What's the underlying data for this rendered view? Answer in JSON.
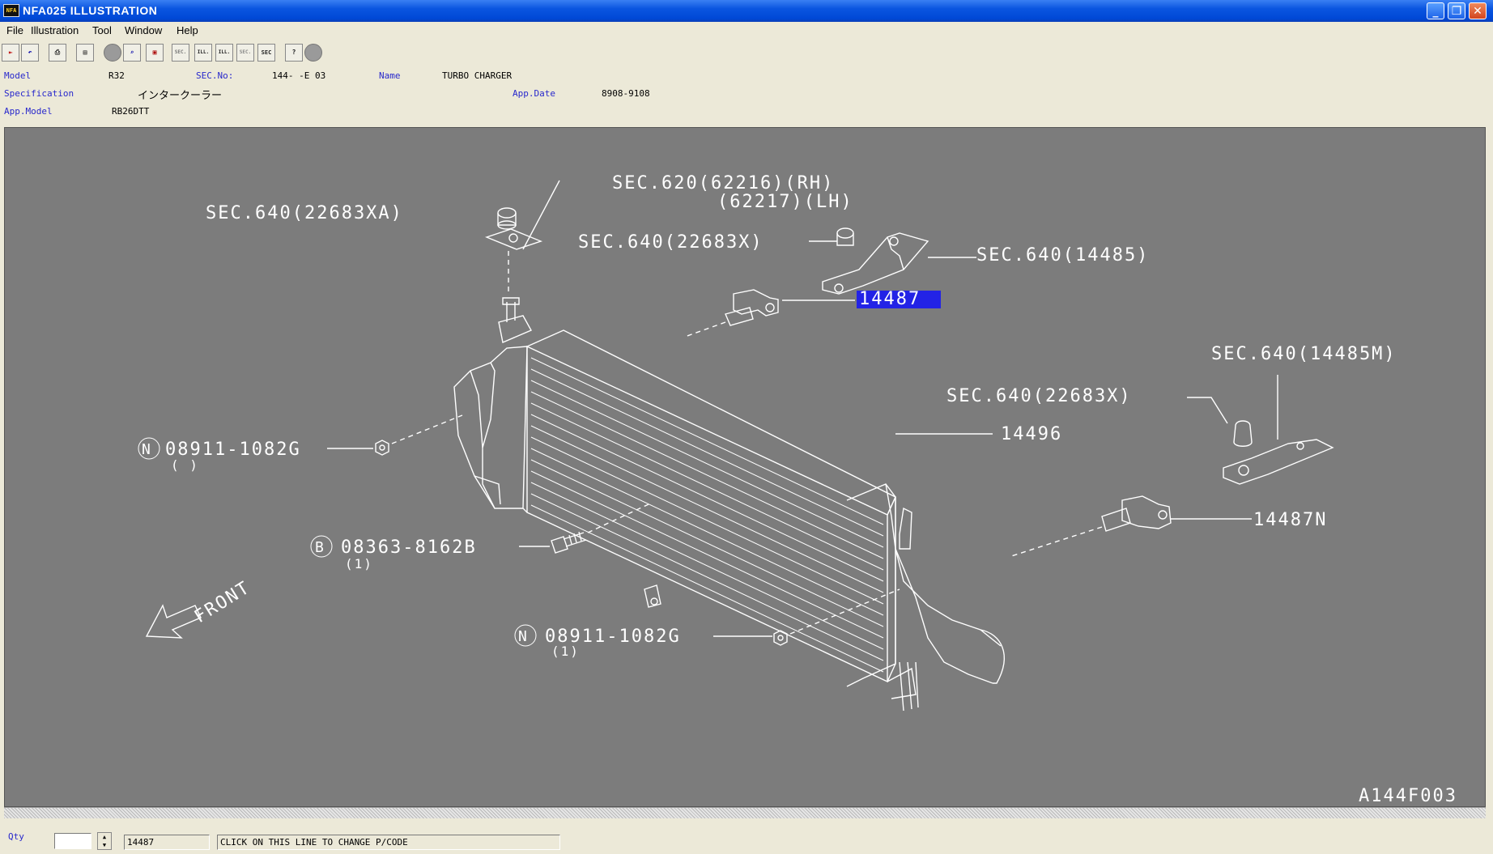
{
  "window": {
    "icon_text": "NFA",
    "title": "NFA025  ILLUSTRATION",
    "minimize_symbol": "_",
    "maximize_symbol": "❐",
    "close_symbol": "✕"
  },
  "menu": [
    "File",
    "Illustration",
    "Tool",
    "Window",
    "Help"
  ],
  "toolbar": {
    "buttons": [
      {
        "name": "exit-icon",
        "glyph": "⇤"
      },
      {
        "name": "undo-icon",
        "glyph": "↶"
      },
      {
        "name": "print-icon",
        "glyph": "⎙"
      },
      {
        "name": "list-icon",
        "glyph": "▤"
      },
      {
        "name": "circle-gray-icon",
        "glyph": ""
      },
      {
        "name": "zoom-icon",
        "glyph": "⌕"
      },
      {
        "name": "catalog-icon",
        "glyph": "▣"
      },
      {
        "name": "sec-ill-icon",
        "glyph": "SEC."
      },
      {
        "name": "ill-prev-icon",
        "glyph": "ILL."
      },
      {
        "name": "ill-next-icon",
        "glyph": "ILL."
      },
      {
        "name": "sec-disabled-icon",
        "glyph": "SEC."
      },
      {
        "name": "sec-icon",
        "glyph": "SEC"
      },
      {
        "name": "help-icon",
        "glyph": "?"
      },
      {
        "name": "stop-icon",
        "glyph": ""
      }
    ]
  },
  "info": {
    "model_label": "Model",
    "model_value": "R32",
    "sec_label": "SEC.No:",
    "sec_value": "144-  -E 03",
    "name_label": "Name",
    "name_value": "TURBO CHARGER",
    "spec_label": "Specification",
    "spec_value": "インタークーラー",
    "appdate_label": "App.Date",
    "appdate_value": "8908-9108",
    "appmodel_label": "App.Model",
    "appmodel_value": "RB26DTT"
  },
  "illustration": {
    "callouts": {
      "sec620_rh": "SEC.620(62216)(RH)",
      "sec620_lh": "(62217)(LH)",
      "sec640_22683xa": "SEC.640(22683XA)",
      "sec640_22683x_top": "SEC.640(22683X)",
      "sec640_14485": "SEC.640(14485)",
      "part_14487": "14487",
      "sec640_14485m": "SEC.640(14485M)",
      "sec640_22683x_right": "SEC.640(22683X)",
      "part_14496": "14496",
      "part_14487n": "14487N",
      "nut_n1_code": "08911-1082G",
      "nut_n1_qty": "(  )",
      "bolt_code": "08363-8162B",
      "bolt_qty": "(1)",
      "nut_n2_code": "08911-1082G",
      "nut_n2_qty": "(1)",
      "front": "FRONT",
      "figure_id": "A144F003",
      "n_mark": "N",
      "b_mark": "B"
    }
  },
  "status": {
    "qty_label": "Qty",
    "qty_value": "",
    "part_code": "14487",
    "message": "CLICK ON THIS LINE TO CHANGE P/CODE"
  }
}
